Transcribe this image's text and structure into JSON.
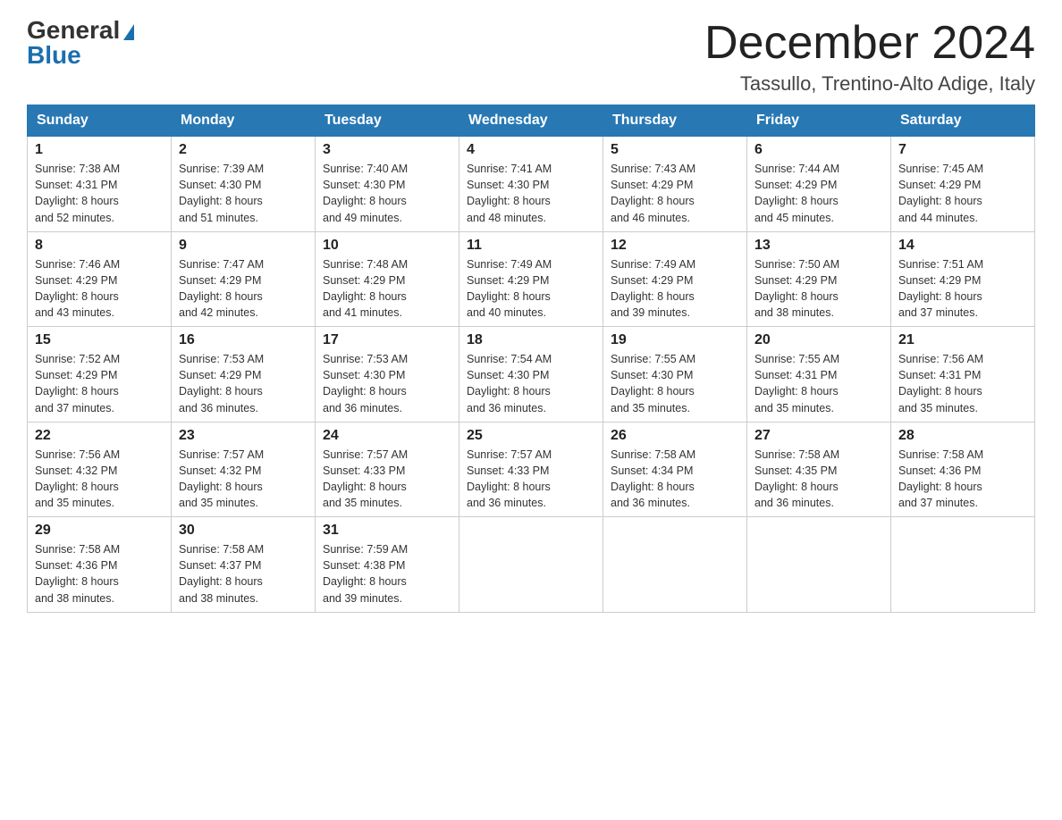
{
  "header": {
    "logo_general": "General",
    "logo_blue": "Blue",
    "month_year": "December 2024",
    "location": "Tassullo, Trentino-Alto Adige, Italy"
  },
  "weekdays": [
    "Sunday",
    "Monday",
    "Tuesday",
    "Wednesday",
    "Thursday",
    "Friday",
    "Saturday"
  ],
  "weeks": [
    [
      {
        "day": "1",
        "sunrise": "7:38 AM",
        "sunset": "4:31 PM",
        "daylight": "8 hours and 52 minutes."
      },
      {
        "day": "2",
        "sunrise": "7:39 AM",
        "sunset": "4:30 PM",
        "daylight": "8 hours and 51 minutes."
      },
      {
        "day": "3",
        "sunrise": "7:40 AM",
        "sunset": "4:30 PM",
        "daylight": "8 hours and 49 minutes."
      },
      {
        "day": "4",
        "sunrise": "7:41 AM",
        "sunset": "4:30 PM",
        "daylight": "8 hours and 48 minutes."
      },
      {
        "day": "5",
        "sunrise": "7:43 AM",
        "sunset": "4:29 PM",
        "daylight": "8 hours and 46 minutes."
      },
      {
        "day": "6",
        "sunrise": "7:44 AM",
        "sunset": "4:29 PM",
        "daylight": "8 hours and 45 minutes."
      },
      {
        "day": "7",
        "sunrise": "7:45 AM",
        "sunset": "4:29 PM",
        "daylight": "8 hours and 44 minutes."
      }
    ],
    [
      {
        "day": "8",
        "sunrise": "7:46 AM",
        "sunset": "4:29 PM",
        "daylight": "8 hours and 43 minutes."
      },
      {
        "day": "9",
        "sunrise": "7:47 AM",
        "sunset": "4:29 PM",
        "daylight": "8 hours and 42 minutes."
      },
      {
        "day": "10",
        "sunrise": "7:48 AM",
        "sunset": "4:29 PM",
        "daylight": "8 hours and 41 minutes."
      },
      {
        "day": "11",
        "sunrise": "7:49 AM",
        "sunset": "4:29 PM",
        "daylight": "8 hours and 40 minutes."
      },
      {
        "day": "12",
        "sunrise": "7:49 AM",
        "sunset": "4:29 PM",
        "daylight": "8 hours and 39 minutes."
      },
      {
        "day": "13",
        "sunrise": "7:50 AM",
        "sunset": "4:29 PM",
        "daylight": "8 hours and 38 minutes."
      },
      {
        "day": "14",
        "sunrise": "7:51 AM",
        "sunset": "4:29 PM",
        "daylight": "8 hours and 37 minutes."
      }
    ],
    [
      {
        "day": "15",
        "sunrise": "7:52 AM",
        "sunset": "4:29 PM",
        "daylight": "8 hours and 37 minutes."
      },
      {
        "day": "16",
        "sunrise": "7:53 AM",
        "sunset": "4:29 PM",
        "daylight": "8 hours and 36 minutes."
      },
      {
        "day": "17",
        "sunrise": "7:53 AM",
        "sunset": "4:30 PM",
        "daylight": "8 hours and 36 minutes."
      },
      {
        "day": "18",
        "sunrise": "7:54 AM",
        "sunset": "4:30 PM",
        "daylight": "8 hours and 36 minutes."
      },
      {
        "day": "19",
        "sunrise": "7:55 AM",
        "sunset": "4:30 PM",
        "daylight": "8 hours and 35 minutes."
      },
      {
        "day": "20",
        "sunrise": "7:55 AM",
        "sunset": "4:31 PM",
        "daylight": "8 hours and 35 minutes."
      },
      {
        "day": "21",
        "sunrise": "7:56 AM",
        "sunset": "4:31 PM",
        "daylight": "8 hours and 35 minutes."
      }
    ],
    [
      {
        "day": "22",
        "sunrise": "7:56 AM",
        "sunset": "4:32 PM",
        "daylight": "8 hours and 35 minutes."
      },
      {
        "day": "23",
        "sunrise": "7:57 AM",
        "sunset": "4:32 PM",
        "daylight": "8 hours and 35 minutes."
      },
      {
        "day": "24",
        "sunrise": "7:57 AM",
        "sunset": "4:33 PM",
        "daylight": "8 hours and 35 minutes."
      },
      {
        "day": "25",
        "sunrise": "7:57 AM",
        "sunset": "4:33 PM",
        "daylight": "8 hours and 36 minutes."
      },
      {
        "day": "26",
        "sunrise": "7:58 AM",
        "sunset": "4:34 PM",
        "daylight": "8 hours and 36 minutes."
      },
      {
        "day": "27",
        "sunrise": "7:58 AM",
        "sunset": "4:35 PM",
        "daylight": "8 hours and 36 minutes."
      },
      {
        "day": "28",
        "sunrise": "7:58 AM",
        "sunset": "4:36 PM",
        "daylight": "8 hours and 37 minutes."
      }
    ],
    [
      {
        "day": "29",
        "sunrise": "7:58 AM",
        "sunset": "4:36 PM",
        "daylight": "8 hours and 38 minutes."
      },
      {
        "day": "30",
        "sunrise": "7:58 AM",
        "sunset": "4:37 PM",
        "daylight": "8 hours and 38 minutes."
      },
      {
        "day": "31",
        "sunrise": "7:59 AM",
        "sunset": "4:38 PM",
        "daylight": "8 hours and 39 minutes."
      },
      null,
      null,
      null,
      null
    ]
  ],
  "labels": {
    "sunrise": "Sunrise:",
    "sunset": "Sunset:",
    "daylight": "Daylight:"
  }
}
